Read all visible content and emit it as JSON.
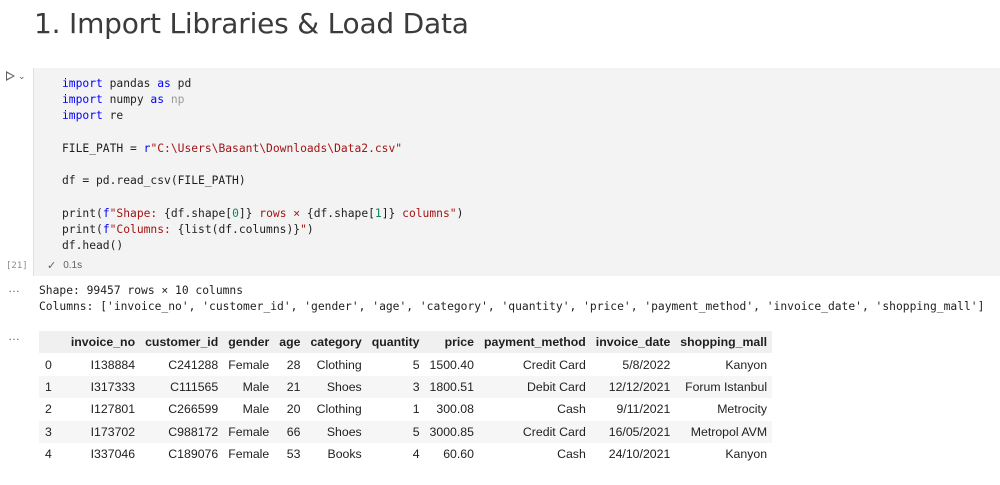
{
  "heading": "1. Import Libraries & Load Data",
  "cell": {
    "execution_count": "[21]",
    "exec_time": "0.1s",
    "code": {
      "l1a": "import",
      "l1b": " pandas ",
      "l1c": "as",
      "l1d": " pd",
      "l2a": "import",
      "l2b": " numpy ",
      "l2c": "as",
      "l2d": " np",
      "l3a": "import",
      "l3b": " re",
      "l5a": "FILE_PATH = ",
      "l5b": "r",
      "l5c": "\"C:\\Users\\Basant\\Downloads\\Data2.csv\"",
      "l7": "df = pd.read_csv(FILE_PATH)",
      "l9a": "print(",
      "l9b": "f",
      "l9c": "\"Shape: ",
      "l9d": "{df.shape[",
      "l9e": "0",
      "l9f": "]}",
      "l9g": " rows × ",
      "l9h": "{df.shape[",
      "l9i": "1",
      "l9j": "]}",
      "l9k": " columns\"",
      "l9l": ")",
      "l10a": "print(",
      "l10b": "f",
      "l10c": "\"Columns: ",
      "l10d": "{list(df.columns)}",
      "l10e": "\"",
      "l10f": ")",
      "l11": "df.head()"
    }
  },
  "output": {
    "line1": "Shape: 99457 rows × 10 columns",
    "line2": "Columns: ['invoice_no', 'customer_id', 'gender', 'age', 'category', 'quantity', 'price', 'payment_method', 'invoice_date', 'shopping_mall']",
    "more_glyph": "…"
  },
  "table": {
    "columns": [
      "",
      "invoice_no",
      "customer_id",
      "gender",
      "age",
      "category",
      "quantity",
      "price",
      "payment_method",
      "invoice_date",
      "shopping_mall"
    ],
    "rows": [
      [
        "0",
        "I138884",
        "C241288",
        "Female",
        "28",
        "Clothing",
        "5",
        "1500.40",
        "Credit Card",
        "5/8/2022",
        "Kanyon"
      ],
      [
        "1",
        "I317333",
        "C111565",
        "Male",
        "21",
        "Shoes",
        "3",
        "1800.51",
        "Debit Card",
        "12/12/2021",
        "Forum Istanbul"
      ],
      [
        "2",
        "I127801",
        "C266599",
        "Male",
        "20",
        "Clothing",
        "1",
        "300.08",
        "Cash",
        "9/11/2021",
        "Metrocity"
      ],
      [
        "3",
        "I173702",
        "C988172",
        "Female",
        "66",
        "Shoes",
        "5",
        "3000.85",
        "Credit Card",
        "16/05/2021",
        "Metropol AVM"
      ],
      [
        "4",
        "I337046",
        "C189076",
        "Female",
        "53",
        "Books",
        "4",
        "60.60",
        "Cash",
        "24/10/2021",
        "Kanyon"
      ]
    ]
  }
}
